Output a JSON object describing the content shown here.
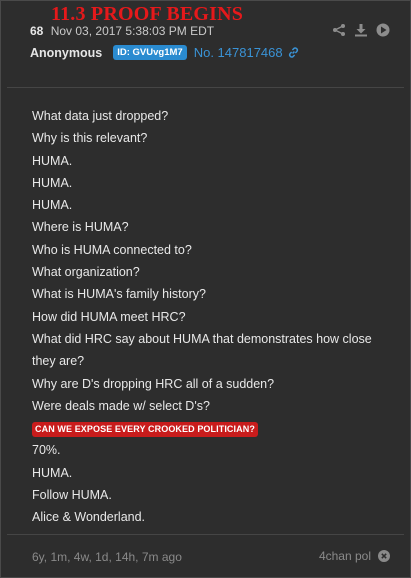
{
  "banner": {
    "text": "11.3 PROOF BEGINS",
    "color": "#e5191b"
  },
  "post": {
    "count": "68",
    "date": "Nov 03, 2017 5:38:03 PM EDT",
    "author": "Anonymous",
    "id_badge": "ID: GVUvg1M7",
    "post_number": "No. 147817468",
    "icons": [
      "share-icon",
      "download-icon",
      "forward-icon",
      "link-icon"
    ]
  },
  "body": {
    "lines": [
      "What data just dropped?",
      "Why is this relevant?",
      "HUMA.",
      "HUMA.",
      "HUMA.",
      "Where is HUMA?",
      "Who is HUMA connected to?",
      "What organization?",
      "What is HUMA's family history?",
      "How did HUMA meet HRC?",
      "What did HRC say about HUMA that demonstrates how close they are?",
      "Why are D's dropping HRC all of a sudden?",
      "Were deals made w/ select D's?",
      "CAN WE EXPOSE EVERY CROOKED POLITICIAN?",
      "70%.",
      "HUMA.",
      "Follow HUMA.",
      "Alice & Wonderland."
    ]
  },
  "footer": {
    "elapsed": "6y, 1m, 4w, 1d, 14h, 7m ago",
    "source": "4chan pol"
  },
  "colors": {
    "background": "#2d2d2d",
    "accent": "#3a93d6",
    "badge": "#2a8bd0",
    "highlight": "#c81c1c"
  }
}
